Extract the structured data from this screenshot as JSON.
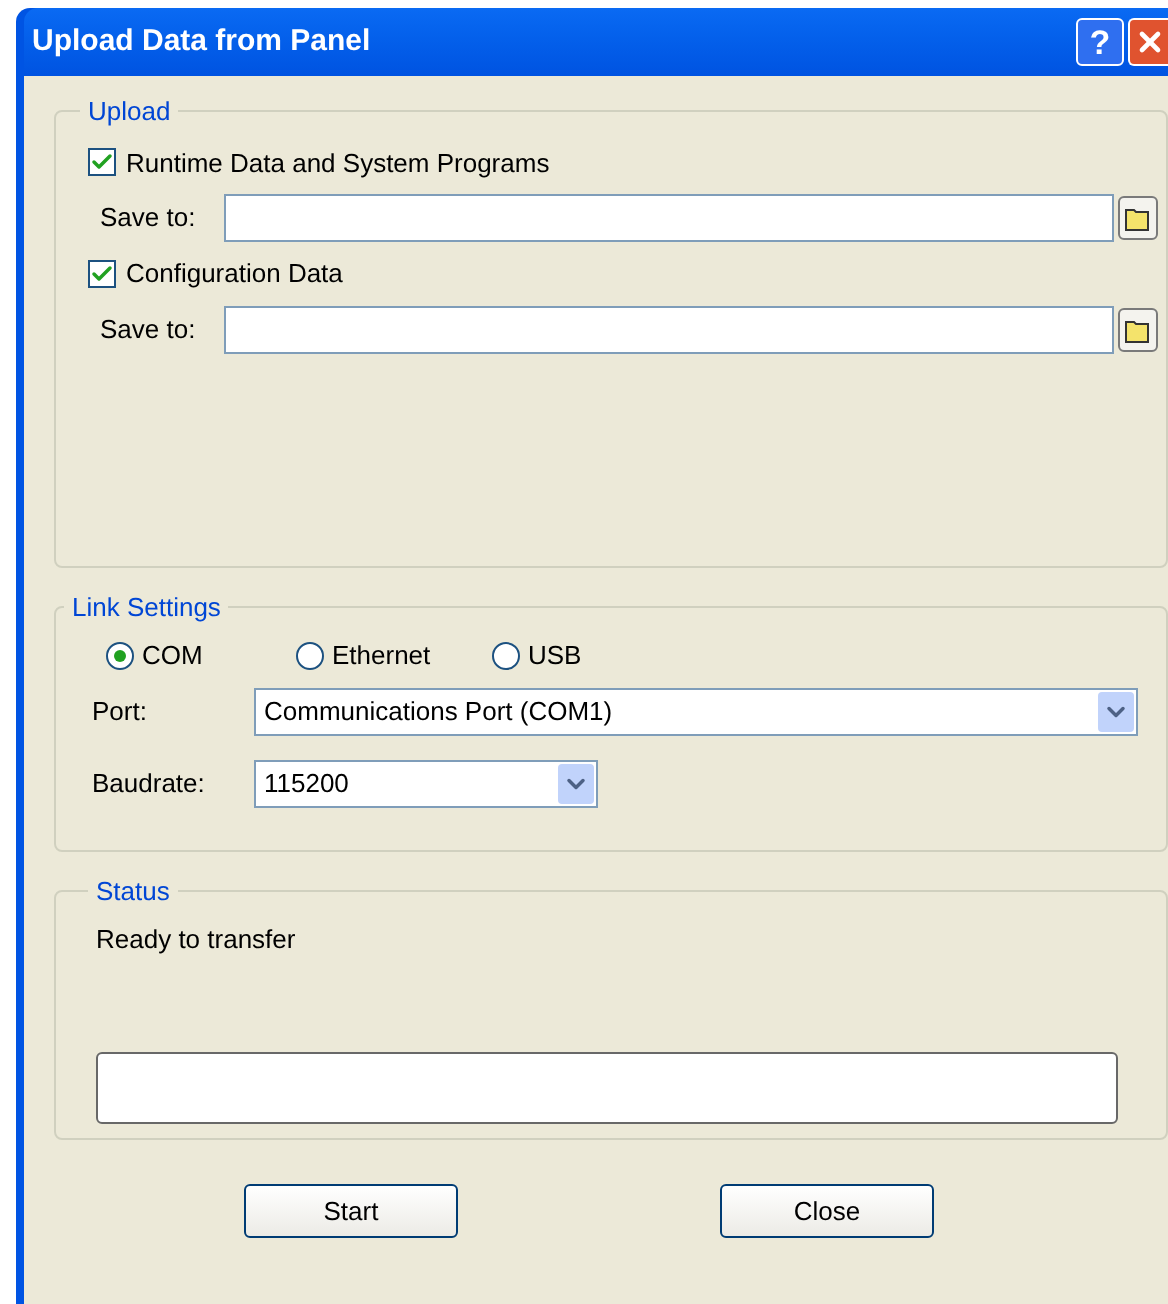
{
  "window": {
    "title": "Upload Data from Panel",
    "help_button": "?"
  },
  "upload": {
    "title": "Upload",
    "items": [
      {
        "label": "Runtime Data and System Programs",
        "checked": true,
        "save_label": "Save to:"
      },
      {
        "label": "Configuration Data",
        "checked": true,
        "save_label": "Save to:"
      }
    ]
  },
  "link_settings": {
    "title": "Link Settings",
    "connections": [
      {
        "label": "COM",
        "selected": true
      },
      {
        "label": "Ethernet",
        "selected": false
      },
      {
        "label": "USB",
        "selected": false
      }
    ],
    "port": {
      "label": "Port:",
      "value": "Communications Port (COM1)"
    },
    "baudrate": {
      "label": "Baudrate:",
      "value": "115200"
    }
  },
  "status": {
    "title": "Status",
    "message": "Ready to transfer"
  },
  "buttons": [
    "Start",
    "Close"
  ]
}
